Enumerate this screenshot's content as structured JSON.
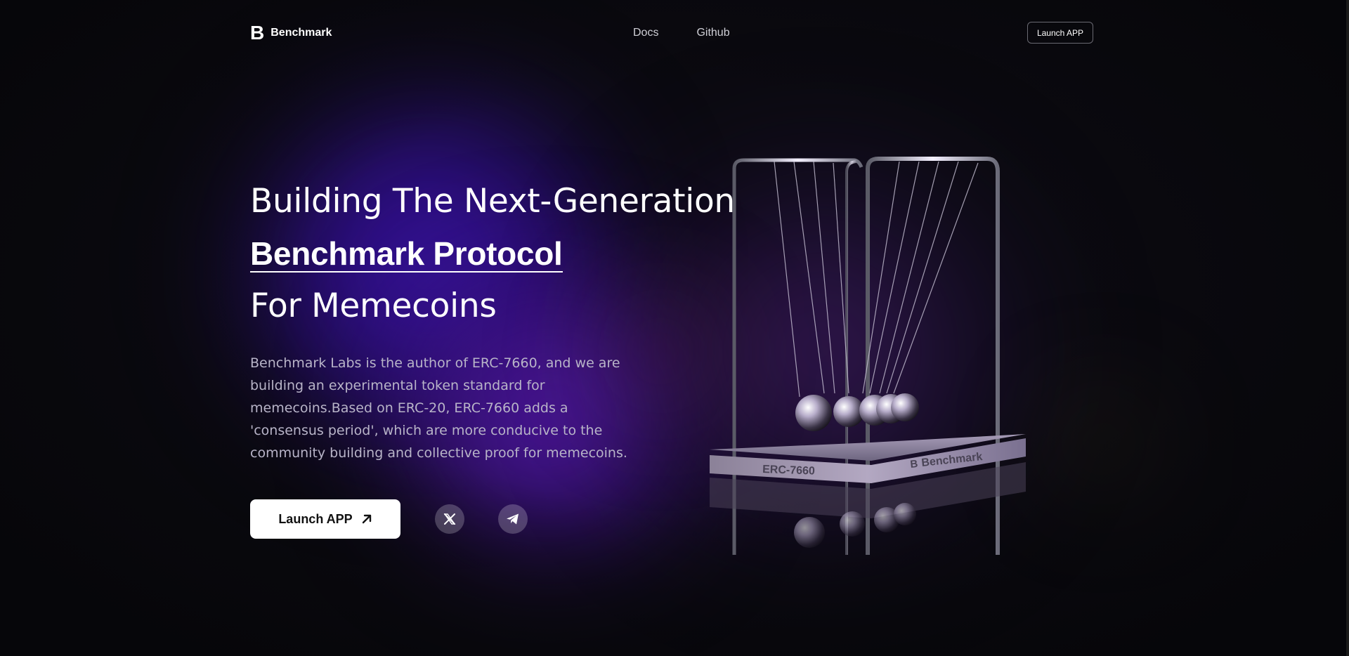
{
  "header": {
    "logo_mark": "B",
    "brand": "Benchmark",
    "nav": [
      {
        "label": "Docs"
      },
      {
        "label": "Github"
      }
    ],
    "launch_label": "Launch APP"
  },
  "hero": {
    "line1": "Building The Next-Generation",
    "line2": "Benchmark Protocol",
    "line3": "For Memecoins",
    "description": "Benchmark Labs is the author of ERC-7660, and we are building an experimental token standard for memecoins.Based on ERC-20, ERC-7660 adds a 'consensus period', which are more conducive to the community building and collective proof for memecoins.",
    "cta_label": "Launch APP",
    "social": [
      {
        "icon": "x-icon"
      },
      {
        "icon": "telegram-icon"
      }
    ]
  },
  "illustration": {
    "base_left_text": "ERC-7660",
    "base_right_text": "Benchmark",
    "base_logo": "B"
  },
  "colors": {
    "background": "#0a0a0c",
    "glow_purple": "#3a14a8",
    "text_muted": "#b8b4c8",
    "button_bg": "#ffffff"
  }
}
